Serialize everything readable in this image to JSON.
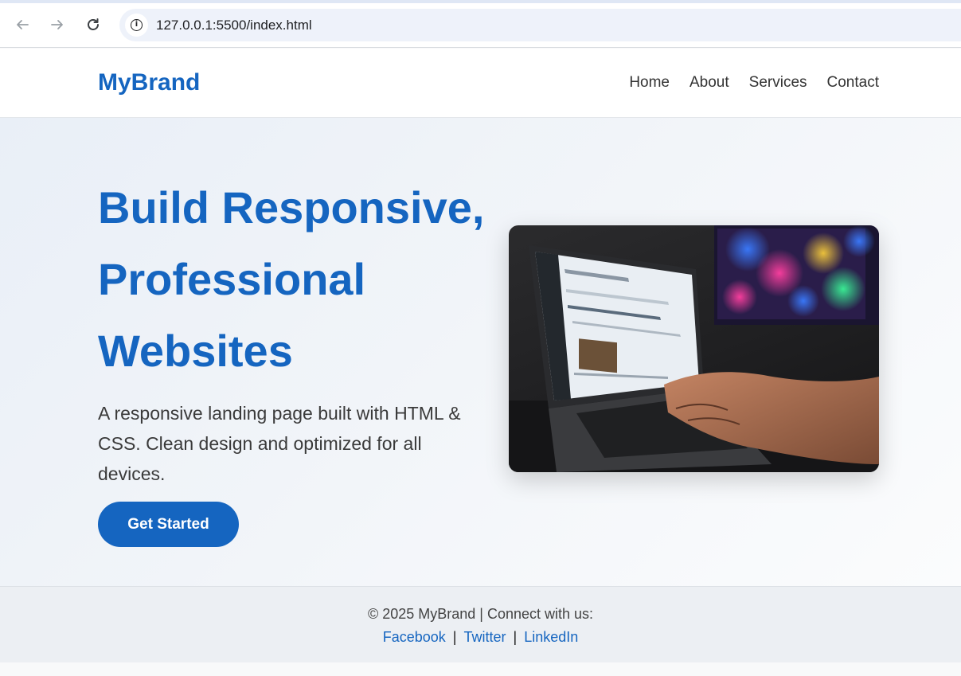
{
  "browser": {
    "url": "127.0.0.1:5500/index.html",
    "icons": {
      "back": "arrow-left-icon",
      "forward": "arrow-right-icon",
      "reload": "reload-icon",
      "info": "info-icon"
    }
  },
  "header": {
    "brand": "MyBrand",
    "nav": [
      "Home",
      "About",
      "Services",
      "Contact"
    ]
  },
  "hero": {
    "title_lines": [
      "Build Responsive,",
      "Professional",
      "Websites"
    ],
    "description": "A responsive landing page built with HTML & CSS. Clean design and optimized for all devices.",
    "cta_label": "Get Started"
  },
  "footer": {
    "copyright": "© 2025 MyBrand | Connect with us:",
    "links": [
      "Facebook",
      "Twitter",
      "LinkedIn"
    ],
    "separator": "|"
  },
  "colors": {
    "brand": "#1565c0",
    "text": "#3a3a3a",
    "footer_bg": "#eceff3"
  }
}
